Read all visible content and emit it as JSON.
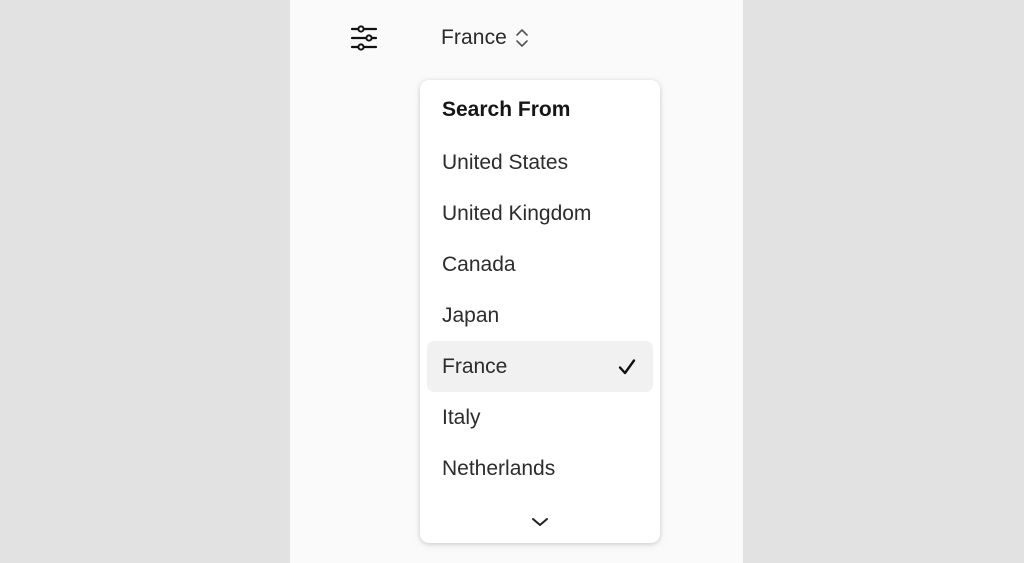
{
  "toolbar": {
    "filter_icon": "sliders-icon",
    "selected_country": "France",
    "selector_icon": "chevron-up-down-icon"
  },
  "dropdown": {
    "title": "Search From",
    "options": [
      {
        "label": "United States",
        "selected": false
      },
      {
        "label": "United Kingdom",
        "selected": false
      },
      {
        "label": "Canada",
        "selected": false
      },
      {
        "label": "Japan",
        "selected": false
      },
      {
        "label": "France",
        "selected": true
      },
      {
        "label": "Italy",
        "selected": false
      },
      {
        "label": "Netherlands",
        "selected": false
      }
    ],
    "check_icon": "checkmark-icon",
    "scroll_icon": "chevron-down-icon"
  },
  "colors": {
    "page_background": "#e2e2e2",
    "panel_background": "#fafafa",
    "menu_background": "#ffffff",
    "selected_row": "#f1f1f1",
    "text": "#1d1d1d"
  }
}
